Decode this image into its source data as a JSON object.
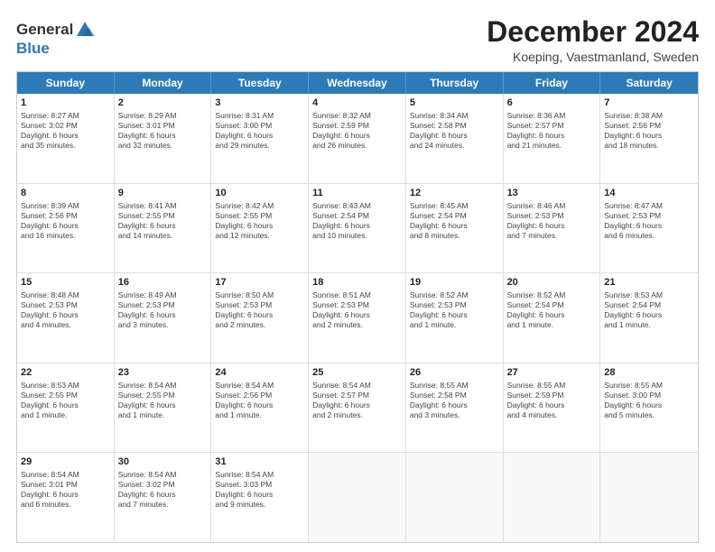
{
  "logo": {
    "general": "General",
    "blue": "Blue"
  },
  "title": "December 2024",
  "subtitle": "Koeping, Vaestmanland, Sweden",
  "header_days": [
    "Sunday",
    "Monday",
    "Tuesday",
    "Wednesday",
    "Thursday",
    "Friday",
    "Saturday"
  ],
  "weeks": [
    [
      {
        "day": "1",
        "lines": [
          "Sunrise: 8:27 AM",
          "Sunset: 3:02 PM",
          "Daylight: 6 hours",
          "and 35 minutes."
        ]
      },
      {
        "day": "2",
        "lines": [
          "Sunrise: 8:29 AM",
          "Sunset: 3:01 PM",
          "Daylight: 6 hours",
          "and 32 minutes."
        ]
      },
      {
        "day": "3",
        "lines": [
          "Sunrise: 8:31 AM",
          "Sunset: 3:00 PM",
          "Daylight: 6 hours",
          "and 29 minutes."
        ]
      },
      {
        "day": "4",
        "lines": [
          "Sunrise: 8:32 AM",
          "Sunset: 2:59 PM",
          "Daylight: 6 hours",
          "and 26 minutes."
        ]
      },
      {
        "day": "5",
        "lines": [
          "Sunrise: 8:34 AM",
          "Sunset: 2:58 PM",
          "Daylight: 6 hours",
          "and 24 minutes."
        ]
      },
      {
        "day": "6",
        "lines": [
          "Sunrise: 8:36 AM",
          "Sunset: 2:57 PM",
          "Daylight: 6 hours",
          "and 21 minutes."
        ]
      },
      {
        "day": "7",
        "lines": [
          "Sunrise: 8:38 AM",
          "Sunset: 2:56 PM",
          "Daylight: 6 hours",
          "and 18 minutes."
        ]
      }
    ],
    [
      {
        "day": "8",
        "lines": [
          "Sunrise: 8:39 AM",
          "Sunset: 2:56 PM",
          "Daylight: 6 hours",
          "and 16 minutes."
        ]
      },
      {
        "day": "9",
        "lines": [
          "Sunrise: 8:41 AM",
          "Sunset: 2:55 PM",
          "Daylight: 6 hours",
          "and 14 minutes."
        ]
      },
      {
        "day": "10",
        "lines": [
          "Sunrise: 8:42 AM",
          "Sunset: 2:55 PM",
          "Daylight: 6 hours",
          "and 12 minutes."
        ]
      },
      {
        "day": "11",
        "lines": [
          "Sunrise: 8:43 AM",
          "Sunset: 2:54 PM",
          "Daylight: 6 hours",
          "and 10 minutes."
        ]
      },
      {
        "day": "12",
        "lines": [
          "Sunrise: 8:45 AM",
          "Sunset: 2:54 PM",
          "Daylight: 6 hours",
          "and 8 minutes."
        ]
      },
      {
        "day": "13",
        "lines": [
          "Sunrise: 8:46 AM",
          "Sunset: 2:53 PM",
          "Daylight: 6 hours",
          "and 7 minutes."
        ]
      },
      {
        "day": "14",
        "lines": [
          "Sunrise: 8:47 AM",
          "Sunset: 2:53 PM",
          "Daylight: 6 hours",
          "and 6 minutes."
        ]
      }
    ],
    [
      {
        "day": "15",
        "lines": [
          "Sunrise: 8:48 AM",
          "Sunset: 2:53 PM",
          "Daylight: 6 hours",
          "and 4 minutes."
        ]
      },
      {
        "day": "16",
        "lines": [
          "Sunrise: 8:49 AM",
          "Sunset: 2:53 PM",
          "Daylight: 6 hours",
          "and 3 minutes."
        ]
      },
      {
        "day": "17",
        "lines": [
          "Sunrise: 8:50 AM",
          "Sunset: 2:53 PM",
          "Daylight: 6 hours",
          "and 2 minutes."
        ]
      },
      {
        "day": "18",
        "lines": [
          "Sunrise: 8:51 AM",
          "Sunset: 2:53 PM",
          "Daylight: 6 hours",
          "and 2 minutes."
        ]
      },
      {
        "day": "19",
        "lines": [
          "Sunrise: 8:52 AM",
          "Sunset: 2:53 PM",
          "Daylight: 6 hours",
          "and 1 minute."
        ]
      },
      {
        "day": "20",
        "lines": [
          "Sunrise: 8:52 AM",
          "Sunset: 2:54 PM",
          "Daylight: 6 hours",
          "and 1 minute."
        ]
      },
      {
        "day": "21",
        "lines": [
          "Sunrise: 8:53 AM",
          "Sunset: 2:54 PM",
          "Daylight: 6 hours",
          "and 1 minute."
        ]
      }
    ],
    [
      {
        "day": "22",
        "lines": [
          "Sunrise: 8:53 AM",
          "Sunset: 2:55 PM",
          "Daylight: 6 hours",
          "and 1 minute."
        ]
      },
      {
        "day": "23",
        "lines": [
          "Sunrise: 8:54 AM",
          "Sunset: 2:55 PM",
          "Daylight: 6 hours",
          "and 1 minute."
        ]
      },
      {
        "day": "24",
        "lines": [
          "Sunrise: 8:54 AM",
          "Sunset: 2:56 PM",
          "Daylight: 6 hours",
          "and 1 minute."
        ]
      },
      {
        "day": "25",
        "lines": [
          "Sunrise: 8:54 AM",
          "Sunset: 2:57 PM",
          "Daylight: 6 hours",
          "and 2 minutes."
        ]
      },
      {
        "day": "26",
        "lines": [
          "Sunrise: 8:55 AM",
          "Sunset: 2:58 PM",
          "Daylight: 6 hours",
          "and 3 minutes."
        ]
      },
      {
        "day": "27",
        "lines": [
          "Sunrise: 8:55 AM",
          "Sunset: 2:59 PM",
          "Daylight: 6 hours",
          "and 4 minutes."
        ]
      },
      {
        "day": "28",
        "lines": [
          "Sunrise: 8:55 AM",
          "Sunset: 3:00 PM",
          "Daylight: 6 hours",
          "and 5 minutes."
        ]
      }
    ],
    [
      {
        "day": "29",
        "lines": [
          "Sunrise: 8:54 AM",
          "Sunset: 3:01 PM",
          "Daylight: 6 hours",
          "and 6 minutes."
        ]
      },
      {
        "day": "30",
        "lines": [
          "Sunrise: 8:54 AM",
          "Sunset: 3:02 PM",
          "Daylight: 6 hours",
          "and 7 minutes."
        ]
      },
      {
        "day": "31",
        "lines": [
          "Sunrise: 8:54 AM",
          "Sunset: 3:03 PM",
          "Daylight: 6 hours",
          "and 9 minutes."
        ]
      },
      {
        "day": "",
        "lines": []
      },
      {
        "day": "",
        "lines": []
      },
      {
        "day": "",
        "lines": []
      },
      {
        "day": "",
        "lines": []
      }
    ]
  ]
}
